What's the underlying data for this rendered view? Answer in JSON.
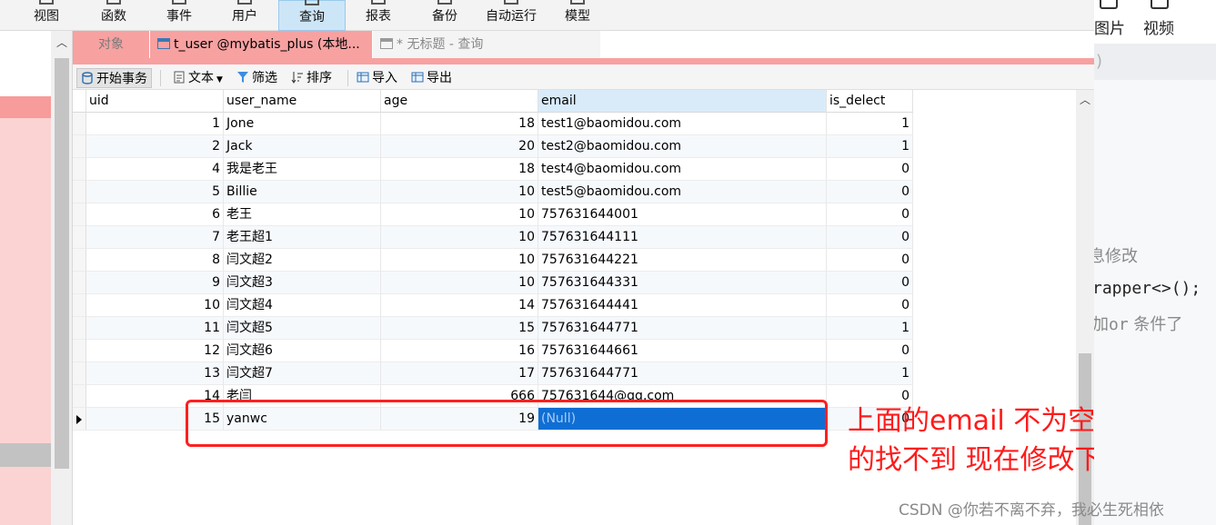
{
  "ribbon": {
    "items": [
      "视图",
      "函数",
      "事件",
      "用户",
      "查询",
      "报表",
      "备份",
      "自动运行",
      "模型"
    ],
    "active": "查询"
  },
  "tabs": {
    "objects_label": "对象",
    "active_label": "t_user @mybatis_plus (本地...",
    "query_label": "* 无标题 - 查询"
  },
  "toolbar": {
    "begin_transaction": "开始事务",
    "text": "文本",
    "filter": "筛选",
    "sort": "排序",
    "import": "导入",
    "export": "导出"
  },
  "table": {
    "columns": [
      "uid",
      "user_name",
      "age",
      "email",
      "is_delect"
    ],
    "rows": [
      {
        "uid": "1",
        "user_name": "Jone",
        "age": "18",
        "email": "test1@baomidou.com",
        "is_delect": "1"
      },
      {
        "uid": "2",
        "user_name": "Jack",
        "age": "20",
        "email": "test2@baomidou.com",
        "is_delect": "1"
      },
      {
        "uid": "4",
        "user_name": "我是老王",
        "age": "18",
        "email": "test4@baomidou.com",
        "is_delect": "0"
      },
      {
        "uid": "5",
        "user_name": "Billie",
        "age": "10",
        "email": "test5@baomidou.com",
        "is_delect": "0"
      },
      {
        "uid": "6",
        "user_name": "老王",
        "age": "10",
        "email": "757631644001",
        "is_delect": "0"
      },
      {
        "uid": "7",
        "user_name": "老王超1",
        "age": "10",
        "email": "757631644111",
        "is_delect": "0"
      },
      {
        "uid": "8",
        "user_name": "闫文超2",
        "age": "10",
        "email": "757631644221",
        "is_delect": "0"
      },
      {
        "uid": "9",
        "user_name": "闫文超3",
        "age": "10",
        "email": "757631644331",
        "is_delect": "0"
      },
      {
        "uid": "10",
        "user_name": "闫文超4",
        "age": "14",
        "email": "757631644441",
        "is_delect": "0"
      },
      {
        "uid": "11",
        "user_name": "闫文超5",
        "age": "15",
        "email": "757631644771",
        "is_delect": "1"
      },
      {
        "uid": "12",
        "user_name": "闫文超6",
        "age": "16",
        "email": "757631644661",
        "is_delect": "0"
      },
      {
        "uid": "13",
        "user_name": "闫文超7",
        "age": "17",
        "email": "757631644771",
        "is_delect": "1"
      },
      {
        "uid": "14",
        "user_name": "老闫",
        "age": "666",
        "email": "757631644@qq.com",
        "is_delect": "0"
      },
      {
        "uid": "15",
        "user_name": "yanwc",
        "age": "19",
        "email": "(Null)",
        "is_delect": "0"
      }
    ]
  },
  "annotation": {
    "line1": "上面的email 不为空我测试",
    "line2": "的找不到 现在修改下"
  },
  "right_panel": {
    "media_labels": [
      "图片",
      "视频"
    ],
    "paren": ")",
    "text1": "息修改",
    "code1": "rapper<>();",
    "code2_kw": "加or",
    "code2_rest": " 条件了"
  },
  "watermark": "CSDN @你若不离不弃，我必生死相依",
  "colors": {
    "selection": "#0f6ed4",
    "annotation_red": "#ff1a1a",
    "tab_pink": "#f7a1a1"
  }
}
